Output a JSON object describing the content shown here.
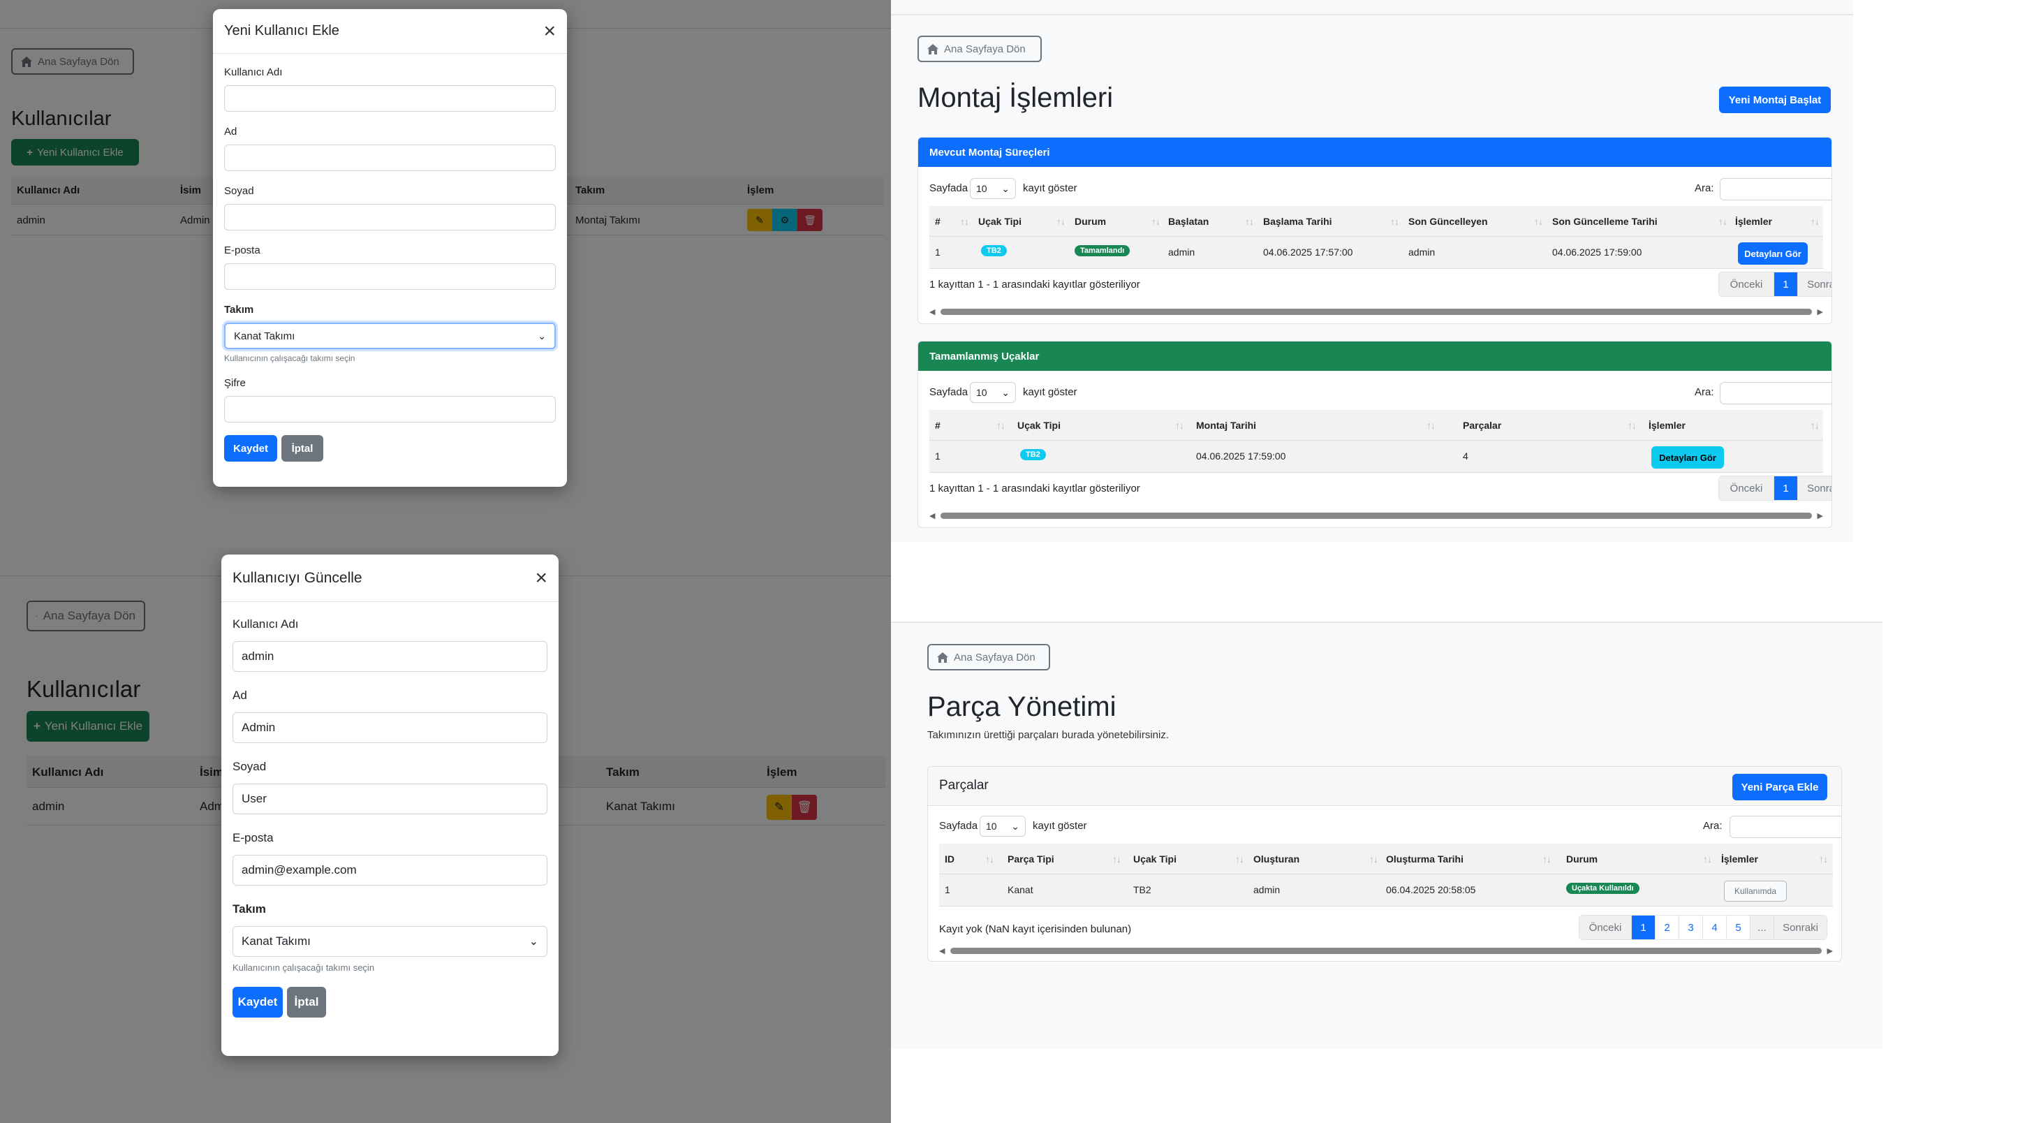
{
  "common": {
    "back_label": "Ana Sayfaya Dön",
    "show_prefix": "Sayfada",
    "page_size": "10",
    "show_suffix": "kayıt göster",
    "search_label": "Ara:",
    "prev": "Önceki",
    "next": "Sonraki",
    "page": "1",
    "info": "1 kayıttan 1 - 1 arasındaki kayıtlar gösteriliyor"
  },
  "users_page": {
    "title": "Kullanıcılar",
    "add_button": "Yeni Kullanıcı Ekle",
    "columns": [
      "Kullanıcı Adı",
      "İsim",
      "Takım",
      "İşlem"
    ],
    "row_add": {
      "username": "admin",
      "name": "Admin",
      "team": "Montaj Takımı"
    },
    "row_update": {
      "username": "admin",
      "name": "Adm",
      "team": "Kanat Takımı"
    }
  },
  "add_modal": {
    "title": "Yeni Kullanıcı Ekle",
    "username_label": "Kullanıcı Adı",
    "name_label": "Ad",
    "surname_label": "Soyad",
    "email_label": "E-posta",
    "team_label": "Takım",
    "team_value": "Kanat Takımı",
    "team_help": "Kullanıcının çalışacağı takımı seçin",
    "password_label": "Şifre",
    "save": "Kaydet",
    "cancel": "İptal"
  },
  "update_modal": {
    "title": "Kullanıcıyı Güncelle",
    "username_label": "Kullanıcı Adı",
    "username_value": "admin",
    "name_label": "Ad",
    "name_value": "Admin",
    "surname_label": "Soyad",
    "surname_value": "User",
    "email_label": "E-posta",
    "email_value": "admin@example.com",
    "team_label": "Takım",
    "team_value": "Kanat Takımı",
    "team_help": "Kullanıcının çalışacağı takımı seçin",
    "save": "Kaydet",
    "cancel": "İptal"
  },
  "assembly": {
    "title": "Montaj İşlemleri",
    "start_button": "Yeni Montaj Başlat",
    "current": {
      "header": "Mevcut Montaj Süreçleri",
      "columns": [
        "#",
        "Uçak Tipi",
        "Durum",
        "Başlatan",
        "Başlama Tarihi",
        "Son Güncelleyen",
        "Son Güncelleme Tarihi",
        "İşlemler"
      ],
      "row": {
        "no": "1",
        "type": "TB2",
        "status": "Tamamlandı",
        "starter": "admin",
        "start_date": "04.06.2025 17:57:00",
        "updater": "admin",
        "update_date": "04.06.2025 17:59:00",
        "action": "Detayları Gör"
      }
    },
    "completed": {
      "header": "Tamamlanmış Uçaklar",
      "columns": [
        "#",
        "Uçak Tipi",
        "Montaj Tarihi",
        "Parçalar",
        "İşlemler"
      ],
      "row": {
        "no": "1",
        "type": "TB2",
        "date": "04.06.2025 17:59:00",
        "parts": "4",
        "action": "Detayları Gör"
      }
    }
  },
  "parts": {
    "title": "Parça Yönetimi",
    "subtitle": "Takımınızın ürettiği parçaları burada yönetebilirsiniz.",
    "card_title": "Parçalar",
    "add_button": "Yeni Parça Ekle",
    "columns": [
      "ID",
      "Parça Tipi",
      "Uçak Tipi",
      "Oluşturan",
      "Oluşturma Tarihi",
      "Durum",
      "İşlemler"
    ],
    "row": {
      "id": "1",
      "part_type": "Kanat",
      "aircraft": "TB2",
      "creator": "admin",
      "date": "06.04.2025 20:58:05",
      "status": "Uçakta Kullanıldı",
      "action": "Kullanımda"
    },
    "info": "Kayıt yok (NaN kayıt içerisinden bulunan)",
    "pages": [
      "1",
      "2",
      "3",
      "4",
      "5",
      "..."
    ]
  },
  "colors": {
    "primary": "#0d6efd",
    "success": "#198754",
    "info": "#0dcaf0",
    "warning": "#ffc107",
    "danger": "#dc3545",
    "secondary": "#6c757d"
  }
}
